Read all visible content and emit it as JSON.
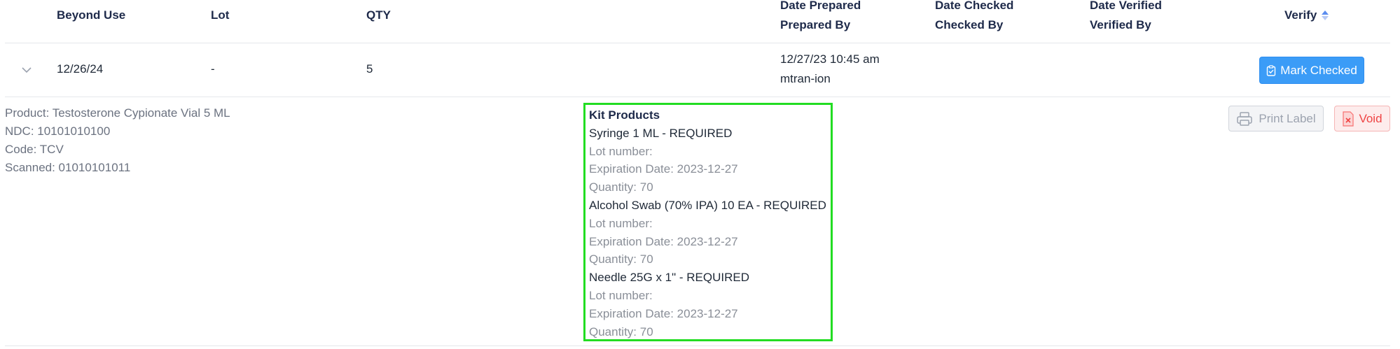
{
  "header": {
    "beyond_use": "Beyond Use",
    "lot": "Lot",
    "qty": "QTY",
    "date_prepared": "Date Prepared",
    "prepared_by": "Prepared By",
    "date_checked": "Date Checked",
    "checked_by": "Checked By",
    "date_verified": "Date Verified",
    "verified_by": "Verified By",
    "verify": "Verify"
  },
  "row": {
    "beyond_use": "12/26/24",
    "lot": "-",
    "qty": "5",
    "date_prepared": "12/27/23 10:45 am",
    "prepared_by": "mtran-ion",
    "mark_checked_label": "Mark Checked"
  },
  "details": {
    "product": "Product: Testosterone Cypionate Vial 5 ML",
    "ndc": "NDC: 10101010100",
    "code": "Code: TCV",
    "scanned": "Scanned: 01010101011"
  },
  "kit": {
    "title": "Kit Products",
    "items": [
      {
        "name": "Syringe 1 ML - REQUIRED",
        "lot": "Lot number:",
        "expiration": "Expiration Date: 2023-12-27",
        "quantity": "Quantity: 70"
      },
      {
        "name": "Alcohol Swab (70% IPA) 10 EA - REQUIRED",
        "lot": "Lot number:",
        "expiration": "Expiration Date: 2023-12-27",
        "quantity": "Quantity: 70"
      },
      {
        "name": "Needle 25G x 1\" - REQUIRED",
        "lot": "Lot number:",
        "expiration": "Expiration Date: 2023-12-27",
        "quantity": "Quantity: 70"
      }
    ]
  },
  "actions": {
    "print_label": "Print Label",
    "void": "Void"
  },
  "icons": {
    "expand": "chevron-down-icon",
    "sort": "sort-icon",
    "clipboard": "clipboard-check-icon",
    "printer": "printer-icon",
    "void_file": "file-x-icon"
  },
  "colors": {
    "primary_button": "#3b9cf7",
    "void_red": "#ef4444",
    "highlight_box": "#22dd22",
    "sort_arrow": "#5b8def"
  }
}
